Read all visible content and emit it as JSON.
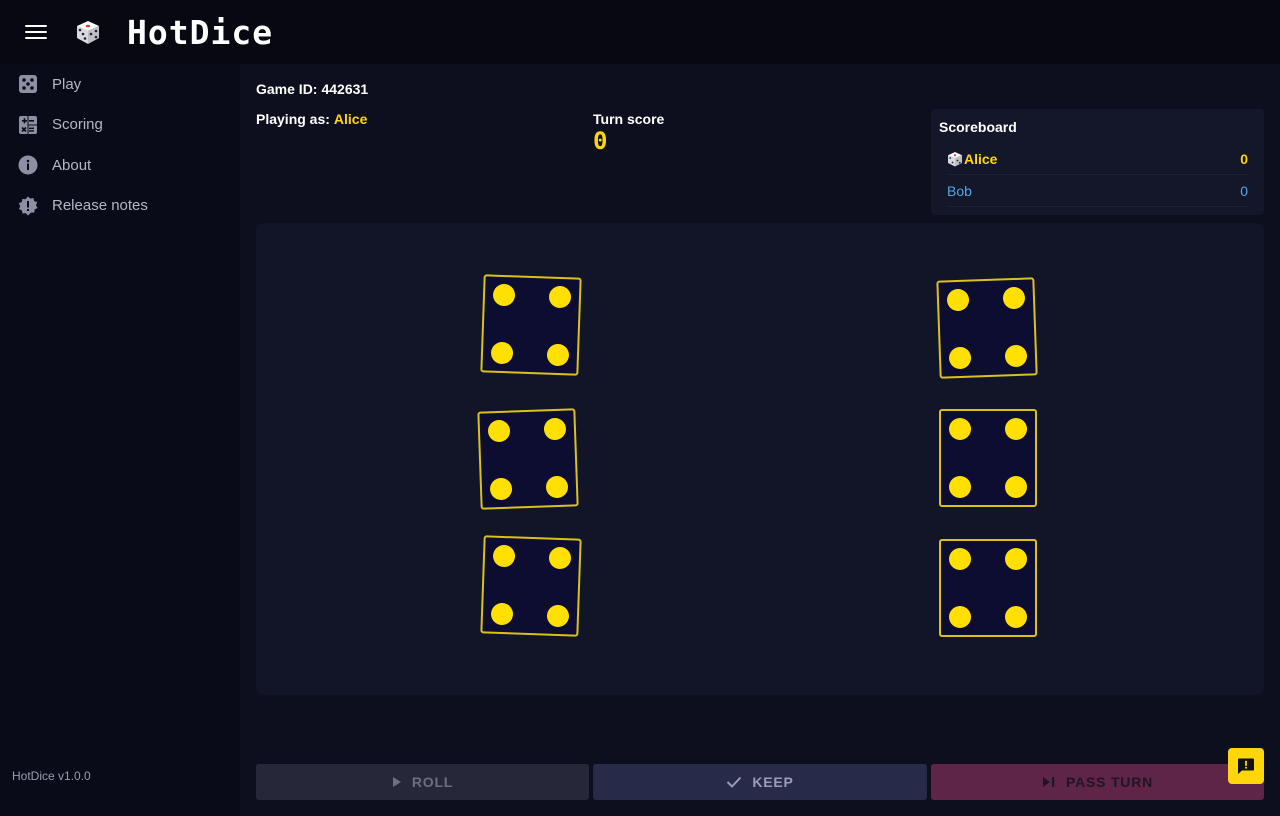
{
  "header": {
    "title": "HotDice",
    "menu_icon": "hamburger-menu-icon",
    "logo_icon": "dice-logo-icon"
  },
  "sidebar": {
    "items": [
      {
        "label": "Play",
        "icon": "dice-five-icon"
      },
      {
        "label": "Scoring",
        "icon": "calculator-icon"
      },
      {
        "label": "About",
        "icon": "info-icon"
      },
      {
        "label": "Release notes",
        "icon": "alert-gear-icon"
      }
    ],
    "version": "HotDice v1.0.0"
  },
  "game": {
    "id_label": "Game ID:",
    "id_value": "442631",
    "playing_as_label": "Playing as:",
    "player_name": "Alice",
    "turn_score_label": "Turn score",
    "turn_score_value": "0"
  },
  "scoreboard": {
    "title": "Scoreboard",
    "players": [
      {
        "name": "Alice",
        "score": "0",
        "active": true
      },
      {
        "name": "Bob",
        "score": "0",
        "active": false
      }
    ]
  },
  "dice": [
    {
      "value": 4
    },
    {
      "value": 4
    },
    {
      "value": 4
    },
    {
      "value": 4
    },
    {
      "value": 4
    },
    {
      "value": 4
    }
  ],
  "actions": {
    "roll_label": "ROLL",
    "keep_label": "KEEP",
    "pass_label": "PASS TURN"
  },
  "colors": {
    "accent": "#ffd60a",
    "background": "#0c0d1a",
    "opponent": "#4ea8e8",
    "pass_button": "#5e2549"
  }
}
